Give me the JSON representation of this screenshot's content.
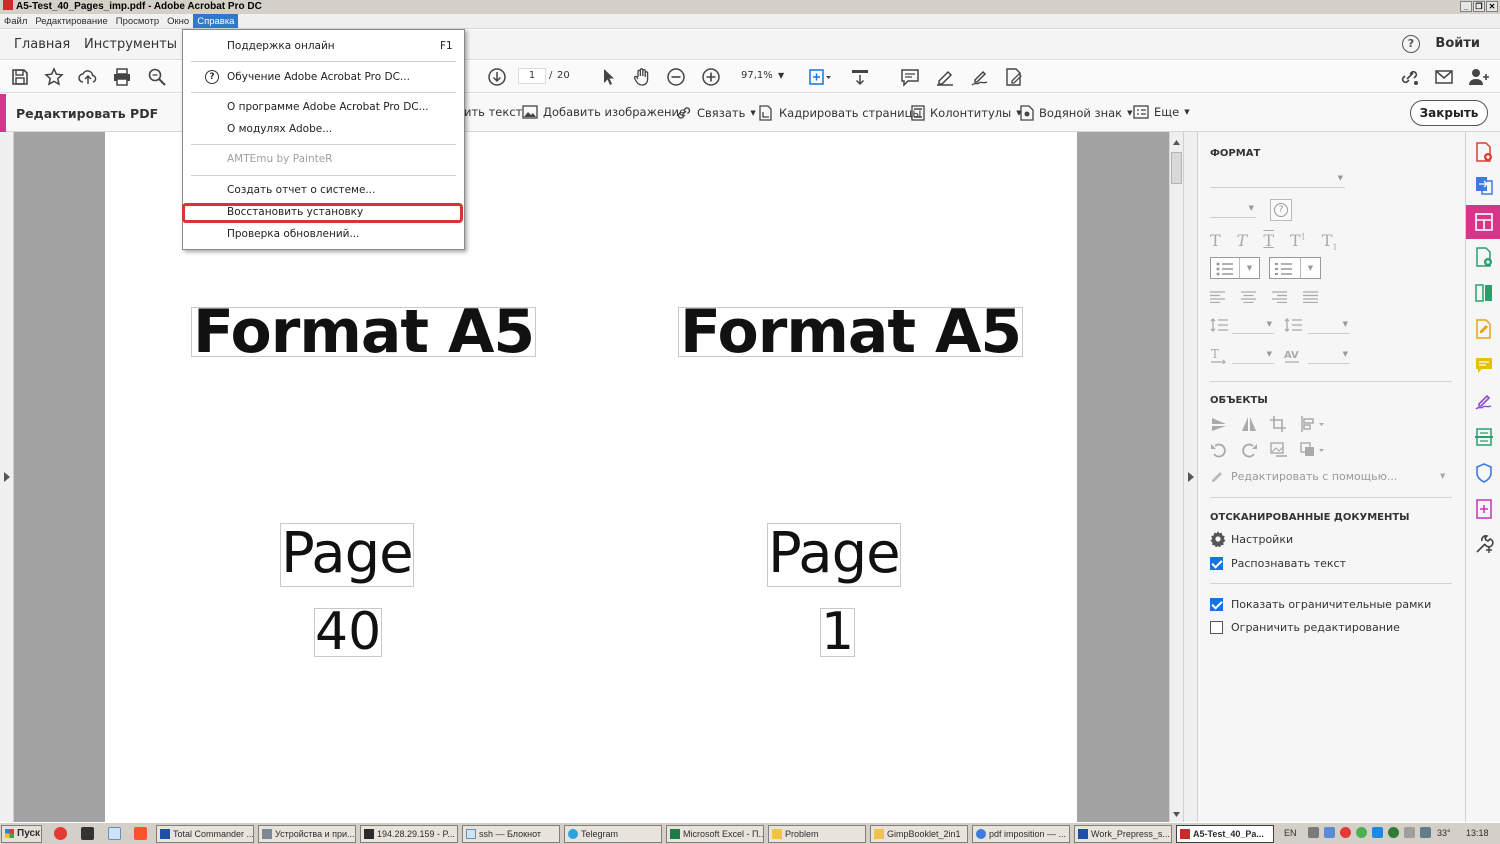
{
  "window": {
    "title": "A5-Test_40_Pages_imp.pdf - Adobe Acrobat Pro DC"
  },
  "menubar": [
    "Файл",
    "Редактирование",
    "Просмотр",
    "Окно",
    "Справка"
  ],
  "nav": {
    "home": "Главная",
    "tools": "Инструменты",
    "login": "Войти",
    "help_icon": "help-icon"
  },
  "toolbar": {
    "page_current": "1",
    "page_sep": "/",
    "page_total": "20",
    "zoom": "97,1%"
  },
  "edit_bar": {
    "title": "Редактировать PDF",
    "edit_text": "ить текст",
    "add_image": "Добавить изображение",
    "link": "Связать",
    "crop": "Кадрировать страницы",
    "headers": "Колонтитулы",
    "watermark": "Водяной знак",
    "more": "Еще",
    "close": "Закрыть"
  },
  "document": {
    "left": {
      "heading": "Format A5",
      "page_word": "Page",
      "page_number": "40"
    },
    "right": {
      "heading": "Format A5",
      "page_word": "Page",
      "page_number": "1"
    }
  },
  "right_panel": {
    "format_title": "ФОРМАТ",
    "objects_title": "ОБЪЕКТЫ",
    "edit_with": "Редактировать с помощью...",
    "scanned_title": "ОТСКАНИРОВАННЫЕ ДОКУМЕНТЫ",
    "settings": "Настройки",
    "recognize_text": "Распознавать текст",
    "recognize_checked": true,
    "show_bounding": "Показать ограничительные рамки",
    "show_bounding_checked": true,
    "restrict_edit": "Ограничить редактирование",
    "restrict_checked": false
  },
  "help_menu": {
    "items": [
      {
        "label": "Поддержка онлайн",
        "shortcut": "F1"
      },
      {
        "label": "Обучение Adobe Acrobat Pro DC..."
      },
      {
        "label": "О программе Adobe Acrobat Pro DC..."
      },
      {
        "label": "О модулях Adobe..."
      },
      {
        "label": "AMTEmu by PainteR",
        "disabled": true
      },
      {
        "label": "Создать отчет о системе..."
      },
      {
        "label": "Восстановить установку",
        "highlighted": true
      },
      {
        "label": "Проверка обновлений..."
      }
    ]
  },
  "taskbar": {
    "start": "Пуск",
    "tasks": [
      "Total Commander ...",
      "Устройства и при...",
      "194.28.29.159 - P...",
      "ssh — Блокнот",
      "Telegram",
      "Microsoft Excel - П...",
      "Problem",
      "GimpBooklet_2in1",
      "pdf imposition — ...",
      "Work_Prepress_s...",
      "A5-Test_40_Pa..."
    ],
    "lang": "EN",
    "temp": "33°",
    "time": "13:18"
  },
  "colors": {
    "accent": "#d73589",
    "menu_active": "#3178c6",
    "highlight_box": "#d93530",
    "checkbox": "#1473e6"
  }
}
